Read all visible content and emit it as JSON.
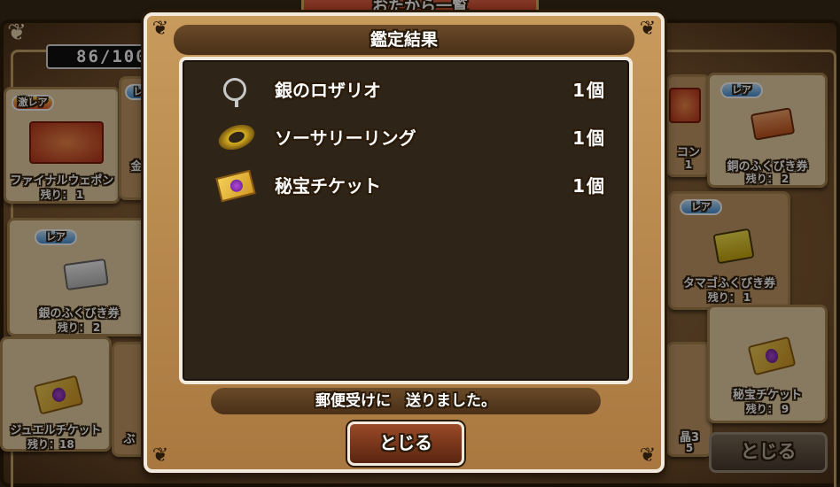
{
  "background": {
    "banner_title": "おたから一覧",
    "counter_text": "86/100",
    "close_label": "とじる",
    "cards": [
      {
        "id": "final-weapon",
        "rarity": "激レア",
        "name": "ファイナルウェポン",
        "remaining_label": "残り：",
        "remaining": "1"
      },
      {
        "id": "silver-ticket",
        "rarity": "レア",
        "name": "銀のふくびき券",
        "remaining_label": "残り：",
        "remaining": "2"
      },
      {
        "id": "jewel-ticket",
        "rarity": "",
        "name": "ジュエルチケット",
        "remaining_label": "残り：",
        "remaining": "18"
      },
      {
        "id": "bronze-ticket",
        "rarity": "レア",
        "name": "銅のふくびき券",
        "remaining_label": "残り：",
        "remaining": "2"
      },
      {
        "id": "egg-ticket",
        "rarity": "レア",
        "name": "タマゴふくびき券",
        "remaining_label": "残り：",
        "remaining": "1"
      },
      {
        "id": "hidden-ticket",
        "rarity": "",
        "name": "秘宝チケット",
        "remaining_label": "残り：",
        "remaining": "9"
      }
    ],
    "partial_labels": {
      "left_gold": "金",
      "left_bottom": "ぶ",
      "right_top_name": "コン",
      "right_top_remain": "1",
      "right_bottom_name": "晶3",
      "right_bottom_remain": "5"
    }
  },
  "modal": {
    "title": "鑑定結果",
    "results": [
      {
        "icon": "rosary-icon",
        "name": "銀のロザリオ",
        "quantity": "1個"
      },
      {
        "icon": "ring-icon",
        "name": "ソーサリーリング",
        "quantity": "1個"
      },
      {
        "icon": "ticket-icon",
        "name": "秘宝チケット",
        "quantity": "1個"
      }
    ],
    "message": "郵便受けに　送りました。",
    "close_label": "とじる"
  },
  "colors": {
    "panel_dark": "#2e2418",
    "frame_light": "#f2eadc",
    "button_red": "#9a4a28",
    "rare_blue": "#4a94d8"
  }
}
